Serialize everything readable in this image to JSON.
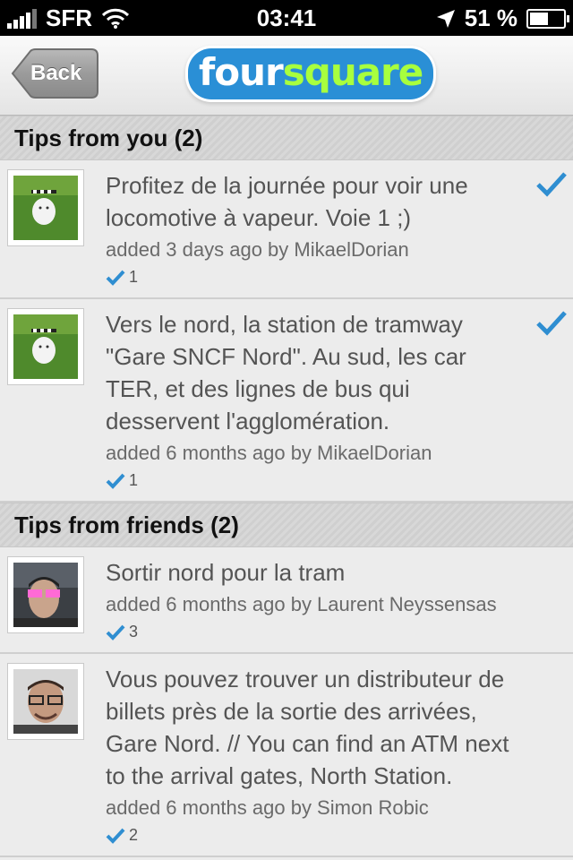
{
  "status_bar": {
    "carrier": "SFR",
    "time": "03:41",
    "battery": "51 %",
    "battery_level": 0.51
  },
  "nav": {
    "back_label": "Back",
    "logo_part1": "four",
    "logo_part2": "square"
  },
  "sections": [
    {
      "title": "Tips from you (2)",
      "tips": [
        {
          "text": "Profitez de la journée pour voir une locomotive à vapeur. Voie 1 ;)",
          "meta": "added 3 days ago by MikaelDorian",
          "count": "1",
          "done": true,
          "avatar": "robot-on-grass"
        },
        {
          "text": "Vers le nord, la station de tramway \"Gare SNCF Nord\". Au sud, les car TER, et des lignes de bus qui desservent l'agglomération.",
          "meta": "added 6 months ago by MikaelDorian",
          "count": "1",
          "done": true,
          "avatar": "robot-on-grass"
        }
      ]
    },
    {
      "title": "Tips from friends (2)",
      "tips": [
        {
          "text": "Sortir nord pour la tram",
          "meta": "added 6 months ago by Laurent Neyssensas",
          "count": "3",
          "done": false,
          "avatar": "man-pink-glasses"
        },
        {
          "text": "Vous pouvez trouver un distributeur de billets près de la sortie des arrivées, Gare Nord.  // You can find an ATM next to the arrival gates, North Station.",
          "meta": "added 6 months ago by Simon Robic",
          "count": "2",
          "done": false,
          "avatar": "man-glasses"
        }
      ]
    }
  ],
  "colors": {
    "check": "#2f8ed1",
    "logo_blue": "#2a8fd6",
    "logo_green": "#a8ff3e"
  }
}
